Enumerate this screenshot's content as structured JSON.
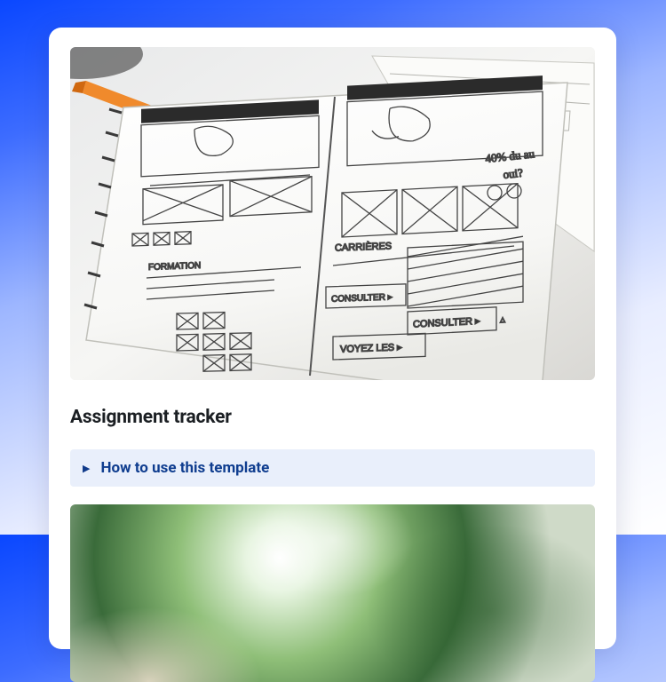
{
  "page": {
    "title": "Assignment tracker"
  },
  "expander": {
    "label": "How to use this template",
    "icon": "▶"
  },
  "hero_image": {
    "alt": "wireframe-sketch-notebook",
    "labels": {
      "formation": "FORMATION",
      "carrieres": "CARRIÈRES",
      "consulter1": "CONSULTER ▸",
      "consulter2": "CONSULTER ▸",
      "voyezles": "VOYEZ LES ▸",
      "promo": "40% du au\noui?"
    }
  }
}
